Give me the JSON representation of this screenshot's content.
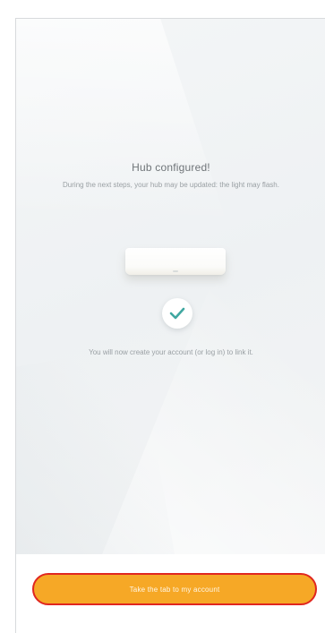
{
  "screen": {
    "title": "Hub configured!",
    "subtitle": "During the next steps, your hub may be updated: the light may flash.",
    "device_icon": "hub-device",
    "status_icon": "checkmark-icon",
    "info": "You will now create your account (or log in) to link it."
  },
  "footer": {
    "button_label": "Take the tab to my account"
  },
  "colors": {
    "accent": "#f6a826",
    "highlight_outline": "#e0261f",
    "check": "#3fa7a0"
  }
}
